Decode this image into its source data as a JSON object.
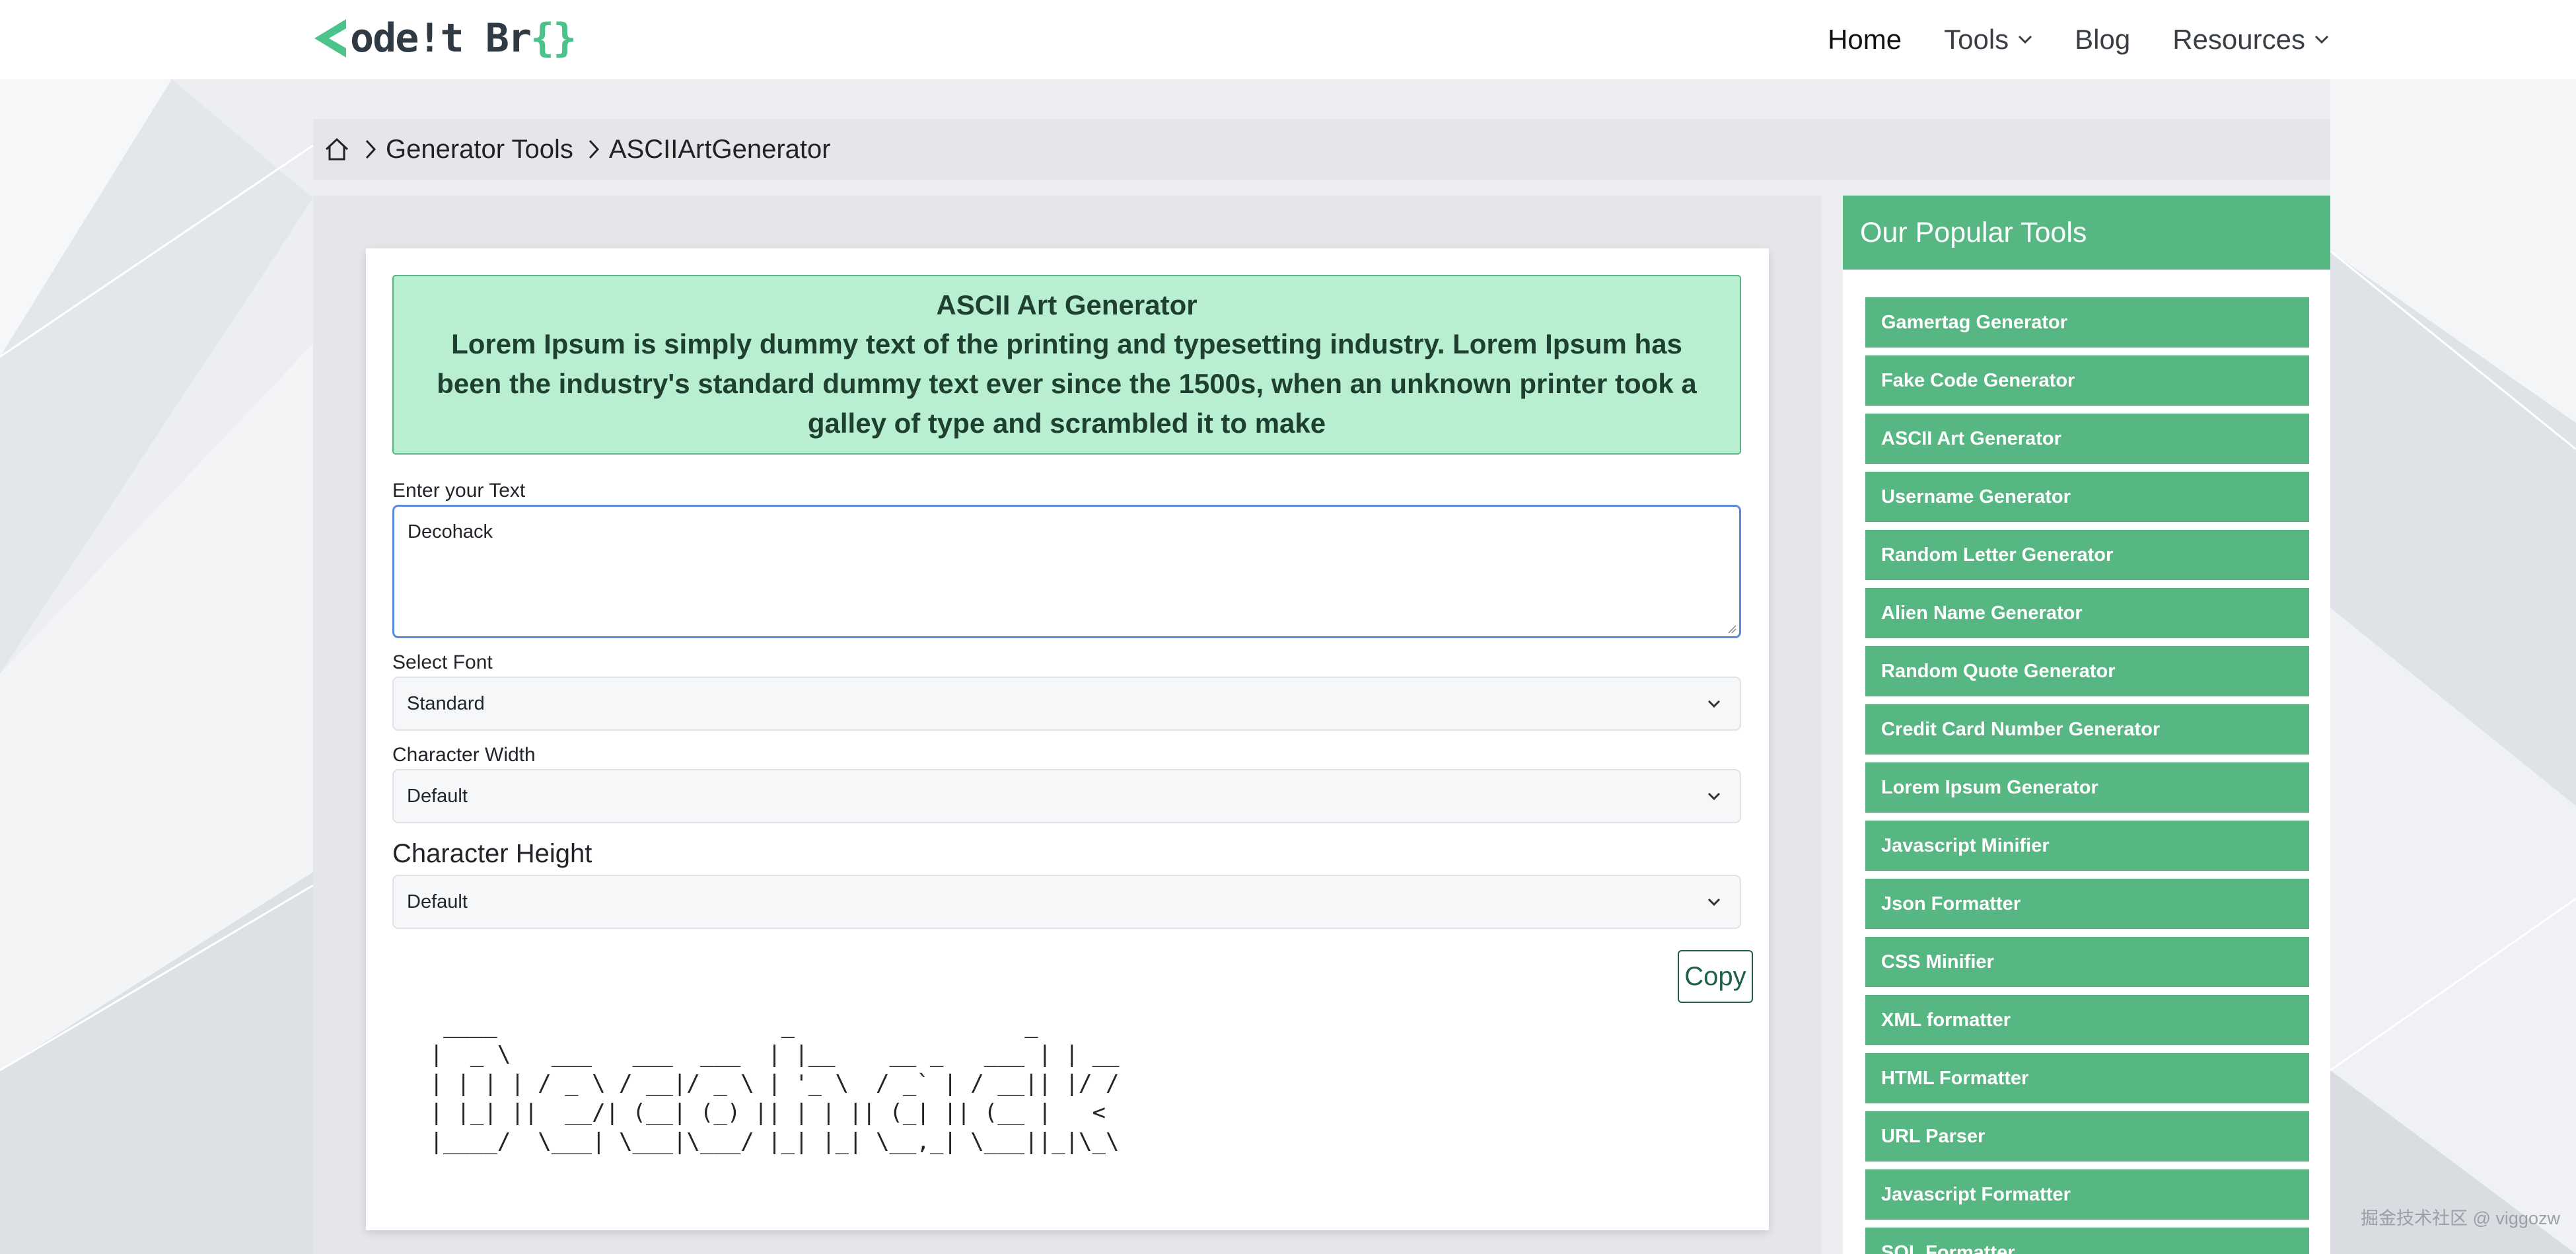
{
  "navbar": {
    "logo_text": "ode!t Br",
    "logo_braces": "{}",
    "items": [
      {
        "label": "Home",
        "dropdown": false,
        "active": true
      },
      {
        "label": "Tools",
        "dropdown": true
      },
      {
        "label": "Blog",
        "dropdown": false
      },
      {
        "label": "Resources",
        "dropdown": true
      }
    ]
  },
  "breadcrumb": {
    "home_icon": "home-icon",
    "items": [
      "Generator Tools",
      "ASCIIArtGenerator"
    ]
  },
  "main": {
    "info_title": "ASCII Art Generator",
    "info_desc": "Lorem Ipsum is simply dummy text of the printing and typesetting industry. Lorem Ipsum has been the industry's standard dummy text ever since the 1500s, when an unknown printer took a galley of type and scrambled it to make",
    "text_label": "Enter your Text",
    "text_value": "Decohack",
    "font_label": "Select Font",
    "font_value": "Standard",
    "width_label": "Character Width",
    "width_value": "Default",
    "height_label": "Character Height",
    "height_value": "Default",
    "copy_label": "Copy",
    "ascii_output": "  ____                     _                 _    \n |  _ \\   ___   ___  ___  | |__    __ _   ___ | | __\n | | | | / _ \\ / __|/ _ \\ | '_ \\  / _` | / __|| |/ /\n | |_| ||  __/| (__| (_) || | | || (_| || (__ |   < \n |____/  \\___| \\___|\\___/ |_| |_| \\__,_| \\___||_|\\_\\"
  },
  "sidebar": {
    "title": "Our Popular Tools",
    "tools": [
      "Gamertag Generator",
      "Fake Code Generator",
      "ASCII Art Generator",
      "Username Generator",
      "Random Letter Generator",
      "Alien Name Generator",
      "Random Quote Generator",
      "Credit Card Number Generator",
      "Lorem Ipsum Generator",
      "Javascript Minifier",
      "Json Formatter",
      "CSS Minifier",
      "XML formatter",
      "HTML Formatter",
      "URL Parser",
      "Javascript Formatter",
      "SQL Formatter"
    ]
  },
  "watermark": "掘金技术社区 @ viggozw",
  "colors": {
    "accent_green": "#57b782",
    "info_bg": "#b8efd1",
    "focus_blue": "#5b8ad9"
  }
}
